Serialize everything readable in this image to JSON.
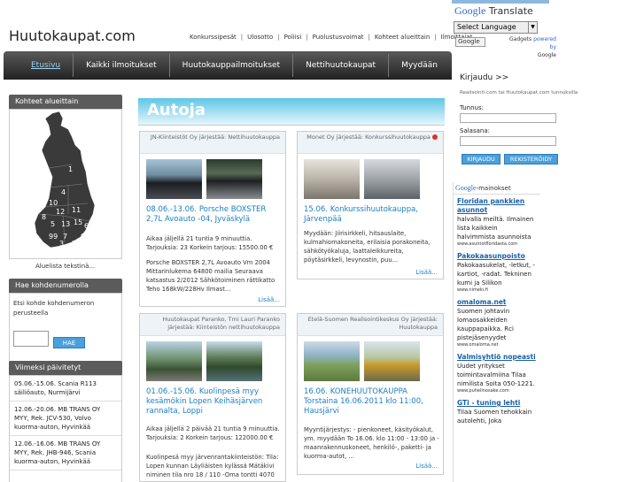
{
  "header": {
    "logo": "Huutokaupat.com",
    "links": [
      "Konkurssipesät",
      "Ulosotto",
      "Poliisi",
      "Puolustusvoimat",
      "Kohteet alueittain",
      "Ilmoittajat"
    ]
  },
  "translate": {
    "title_google": "Google",
    "title_rest": "Translate",
    "select_value": "Select Language",
    "small_input": "Google",
    "powered_prefix": "Gadgets",
    "powered_by": "powered by",
    "powered_google": "Google"
  },
  "nav": {
    "items": [
      "Etusivu",
      "Kaikki ilmoitukset",
      "Huutokauppailmoitukset",
      "Nettihuutokaupat",
      "Myydään"
    ]
  },
  "left": {
    "map_title": "Kohteet alueittain",
    "map_numbers": [
      "1",
      "4",
      "10",
      "12",
      "11",
      "8",
      "5",
      "13",
      "15",
      "6",
      "99",
      "7",
      "3",
      "2",
      "9"
    ],
    "map_caption": "Aluelista tekstinä...",
    "search_title": "Hae kohdenumerolla",
    "search_text": "Etsi kohde kohdenumeron perusteella",
    "search_button": "HAE",
    "recent_title": "Viimeksi päivitetyt",
    "recent_items": [
      "05.06.-15.06. Scania R113 säiliöauto, Nurmijärvi",
      "12.06.-20.06. MB TRANS OY MYY, Rek. JCV-530, Volvo kuorma-auton, Hyvinkää",
      "12.06.-16.06. MB TRANS OY MYY, Rek. JHB-946, Scania kuorma-auton, Hyvinkää"
    ]
  },
  "main": {
    "heading": "Autoja",
    "cards": [
      {
        "head": "JN-Kiinteistöt Oy järjestää: Nettihuutokauppa",
        "title": "08.06.-13.06. Porsche BOXSTER 2,7L Avoauto -04, Jyväskylä",
        "text1": "Aikaa jäljellä 21 tuntia 9 minuuttia. Tarjouksia: 23 Korkein tarjous: 15500.00 €",
        "text2": "Porsche BOXSTER 2,7L Avoauto Vm 2004 Mittarinlukema 64800 mailia Seuraava katsastus 2/2012 Sähkötoiminen rättikatto Teho 168kW/228Hv Ilmast...",
        "more": "Lisää..."
      },
      {
        "head": "Monet Oy järjestää: Konkurssihuutokauppa",
        "title": "15.06. Konkurssihuutokauppa, Järvenpää",
        "text1": "Myydään: Jiirisirkkeli, hitsauslaite, kulmahiomakoneita, erilaisia porakoneita, sähkötyökaluja, laattaleikkureita, pöytäsirkkeli, levynostin, puu...",
        "text2": "",
        "more": "Lisää..."
      },
      {
        "head": "Huutokaupat Paranko, Tmi Lauri Paranko järjestää: Kiinteistön nettihuutokauppa",
        "title": "01.06.-15.06. Kuolinpesä myy kesämökin Lopen Keihäsjärven rannalta, Loppi",
        "text1": "Aikaa jäljellä 2 päivää 21 tuntia 9 minuuttia. Tarjouksia: 2 Korkein tarjous: 122000.00 €",
        "text2": "Kuolinpesä myy järvenrantakiinteistön: Tila: Lopen kunnan Läyliäisten kylässä Mätäkivi niminen tila nro 18 / 110 -Oma tontti 4070",
        "more": ""
      },
      {
        "head": "Etelä-Suomen Realisointikeskus Oy järjestää: Huutokauppa",
        "title": "16.06. KONEHUUTOKAUPPA Torstaina 16.06.2011 klo 11:00, Hausjärvi",
        "text1": "Myyntijärjestys: - pienkoneet, käsityökalut, ym. myydään To 16.06. klo 11:00 - 13:00 ja - maanrakennuskoneet, henkilö-, paketti- ja kuorma-autot, ...",
        "text2": "",
        "more": "Lisää..."
      }
    ]
  },
  "login": {
    "title": "Kirjaudu >>",
    "subtitle": "Realisointi.com tai Huutokaupat.com tunnuksilla",
    "username_label": "Tunnus:",
    "password_label": "Salasana:",
    "login_button": "KIRJAUDU",
    "register_button": "REKISTERÖIDY"
  },
  "ads": {
    "header_google": "Google",
    "header_rest": "-mainokset",
    "items": [
      {
        "title": "Floridan pankkien asunnot",
        "desc": "halvalla meiltä. Ilmainen lista kaikkein halvimmista asunnoista",
        "url": "www.asuntotfloridasta.com"
      },
      {
        "title": "Pakokaasunpoisto",
        "desc": "Pakokaasukelat, -letkut, -kartiot, -radat. Tekninen kumi ja Silikon",
        "url": "www.nimeki.fi"
      },
      {
        "title": "omaloma.net",
        "desc": "Suomen johtavin lomaosakkeiden kauppapaikka. Rci pistejäsenyydet",
        "url": "www.omaloma.net"
      },
      {
        "title": "Valmisyhtiö nopeasti",
        "desc": "Uudet yritykset toimintavalmiina Tilaa nimilista Soita 050-1221.",
        "url": "www.puhelinosake.com"
      },
      {
        "title": "GTi - tuning lehti",
        "desc": "Tilaa Suomen tehokkain autolehti, Joka",
        "url": ""
      }
    ]
  }
}
